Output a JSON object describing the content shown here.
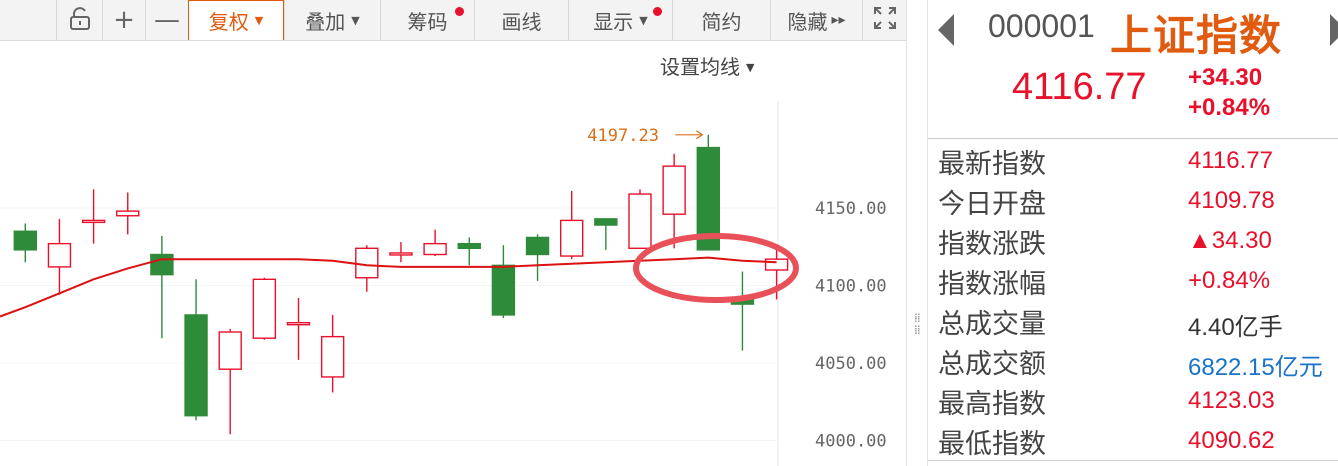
{
  "toolbar": {
    "items": [
      {
        "name": "unlock-button",
        "icon": "unlock-icon",
        "label": "",
        "kind": "icon"
      },
      {
        "name": "zoom-in-button",
        "label": "+",
        "kind": "sym"
      },
      {
        "name": "zoom-out-button",
        "label": "—",
        "kind": "sym"
      },
      {
        "name": "adjust-rights-button",
        "label": "复权",
        "caret": true,
        "active": true
      },
      {
        "name": "overlay-button",
        "label": "叠加",
        "caret": true
      },
      {
        "name": "chips-button",
        "label": "筹码",
        "dot": true
      },
      {
        "name": "draw-line-button",
        "label": "画线"
      },
      {
        "name": "display-button",
        "label": "显示",
        "caret": true,
        "dot": true
      },
      {
        "name": "simple-button",
        "label": "简约"
      },
      {
        "name": "hide-button",
        "label": "隐藏",
        "suffix": "▸▸"
      },
      {
        "name": "fullscreen-button",
        "icon": "fullscreen-icon",
        "label": "",
        "kind": "icon"
      }
    ]
  },
  "ma_setting": {
    "label": "设置均线"
  },
  "chart_data": {
    "type": "candlestick",
    "up_color": "#e8102b",
    "down_color": "#2e8b3a",
    "ma_color": "#dd1111",
    "ylim": [
      3995,
      4200
    ],
    "yticks": [
      "4150.00",
      "4100.00",
      "4050.00",
      "4000.00"
    ],
    "high_marker": "4197.23",
    "candles": [
      {
        "o": 4135,
        "c": 4123,
        "h": 4140,
        "l": 4115
      },
      {
        "o": 4112,
        "c": 4127,
        "h": 4143,
        "l": 4094
      },
      {
        "o": 4142,
        "c": 4142,
        "h": 4162,
        "l": 4127
      },
      {
        "o": 4145,
        "c": 4148,
        "h": 4160,
        "l": 4133
      },
      {
        "o": 4120,
        "c": 4107,
        "h": 4132,
        "l": 4066
      },
      {
        "o": 4081,
        "c": 4016,
        "h": 4104,
        "l": 4013
      },
      {
        "o": 4046,
        "c": 4070,
        "h": 4072,
        "l": 4004
      },
      {
        "o": 4066,
        "c": 4104,
        "h": 4105,
        "l": 4065
      },
      {
        "o": 4076,
        "c": 4076,
        "h": 4092,
        "l": 4052
      },
      {
        "o": 4041,
        "c": 4067,
        "h": 4081,
        "l": 4031
      },
      {
        "o": 4105,
        "c": 4124,
        "h": 4126,
        "l": 4096
      },
      {
        "o": 4121,
        "c": 4121,
        "h": 4128,
        "l": 4115
      },
      {
        "o": 4120,
        "c": 4127,
        "h": 4136,
        "l": 4119
      },
      {
        "o": 4127,
        "c": 4124,
        "h": 4131,
        "l": 4113
      },
      {
        "o": 4113,
        "c": 4081,
        "h": 4126,
        "l": 4079
      },
      {
        "o": 4131,
        "c": 4120,
        "h": 4133,
        "l": 4103
      },
      {
        "o": 4119,
        "c": 4142,
        "h": 4161,
        "l": 4117
      },
      {
        "o": 4143,
        "c": 4139,
        "h": 4143,
        "l": 4123
      },
      {
        "o": 4124,
        "c": 4159,
        "h": 4162,
        "l": 4124
      },
      {
        "o": 4146,
        "c": 4177,
        "h": 4185,
        "l": 4124
      },
      {
        "o": 4189,
        "c": 4123,
        "h": 4197.23,
        "l": 4123
      },
      {
        "o": 4092,
        "c": 4088,
        "h": 4109,
        "l": 4058
      },
      {
        "o": 4110,
        "c": 4117,
        "h": 4123,
        "l": 4091
      }
    ],
    "ma": [
      4086,
      4095,
      4104,
      4111,
      4117,
      4117,
      4117,
      4117,
      4117,
      4116,
      4113,
      4112,
      4112,
      4112,
      4112,
      4113,
      4114,
      4115,
      4116,
      4117,
      4118,
      4116,
      4115
    ]
  },
  "quote": {
    "code": "000001",
    "name": "上证指数",
    "last": "4116.77",
    "change": "+34.30",
    "change_pct": "+0.84%",
    "rows": [
      {
        "label": "最新指数",
        "value": "4116.77",
        "color": "#e8102b"
      },
      {
        "label": "今日开盘",
        "value": "4109.78",
        "color": "#e8102b"
      },
      {
        "label": "指数涨跌",
        "value": "▲34.30",
        "color": "#e8102b"
      },
      {
        "label": "指数涨幅",
        "value": "+0.84%",
        "color": "#e8102b"
      },
      {
        "label": "总成交量",
        "value": "4.40亿手",
        "color": "#333333"
      },
      {
        "label": "总成交额",
        "value": "6822.15亿元",
        "color": "#1a73c8"
      },
      {
        "label": "最高指数",
        "value": "4123.03",
        "color": "#e8102b"
      },
      {
        "label": "最低指数",
        "value": "4090.62",
        "color": "#e8102b"
      }
    ]
  }
}
